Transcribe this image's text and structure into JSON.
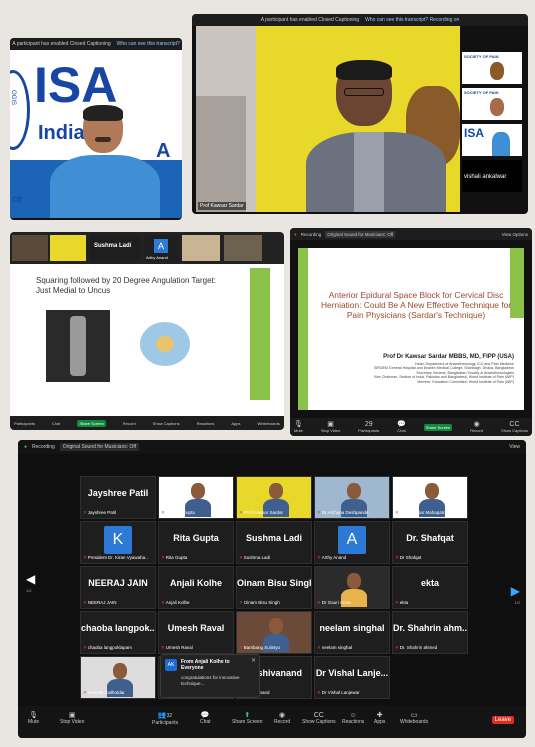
{
  "top_left": {
    "banner": "A participant has enabled Closed Captioning",
    "banner_q": "Who can see this transcript?",
    "logo": "ISA",
    "logo_sub1": "India",
    "logo_sub2": "A",
    "logo_side": "OGIS",
    "logo_side2": "ce"
  },
  "top_right": {
    "banner": "A participant has enabled Closed Captioning",
    "banner_q": "Who can see this transcript? Recording on",
    "speaker_label": "Prof Kawsar Sardar",
    "thumbs": [
      {
        "label": "SOCIETY OF PAIN"
      },
      {
        "label": "SOCIETY OF PAIN"
      },
      {
        "label": "ISA"
      },
      {
        "label": "vishali ankalwar"
      }
    ]
  },
  "mid_left": {
    "names": [
      "Sushma Ladi",
      "Arthy Anand",
      "A"
    ],
    "slide_title": "Squaring followed by 20 Degree Angulation Target: Just Medial to Uncus",
    "toolbar": [
      "Participants",
      "Chat",
      "Share Screen",
      "Record",
      "Show Captions",
      "Reactions",
      "Apps",
      "Whiteboards"
    ]
  },
  "mid_right": {
    "recording": "Recording",
    "sound": "Original Sound for Musicians: Off",
    "view": "View Options",
    "slide_title": "Anterior Epidural Space Block for Cervical Disc Herniation: Could Be A New Effective Technique for Pain Physicians (Sardar's Technique)",
    "presenter": "Prof Dr Kawsar Sardar MBBS, MD, FIPP (USA)",
    "lines": [
      "Head, Department of Anaesthesiology, ICU and Pain Medicine",
      "SIRDEM General Hospital and Ibrahim Medical College, Shahbagh, Dhaka, Bangladesh",
      "Secretary General, Bangladesh Society of Anaesthesiologists",
      "Vice Chairman, Section of India, Pakistan and Bangladesh, World Institute of Pain (WIP)",
      "Member, Education Committee, World Institute of Pain (WIP)"
    ],
    "toolbar": [
      "Mute",
      "Stop Video",
      "Participants",
      "Chat",
      "Share Screen",
      "Record",
      "Show Captions"
    ],
    "participants_count": "29"
  },
  "bottom": {
    "recording": "Recording",
    "sound": "Original Sound for Musicians: Off",
    "view": "View",
    "page_left": "1/2",
    "page_right": "1/2",
    "tiles": [
      {
        "name": "Jayshree Patil",
        "sub": "Jayshree Patil"
      },
      {
        "name": "",
        "sub": "Sumitra Gupta"
      },
      {
        "name": "",
        "sub": "Prof Kawsar Sardar"
      },
      {
        "name": "",
        "sub": "Dr Archana Deshpande"
      },
      {
        "name": "",
        "sub": "Prof Kawsar Mahapatra"
      },
      {
        "name": "",
        "sub": "President Dr. Kiran Vyawaha..."
      },
      {
        "name": "Rita Gupta",
        "sub": "Rita Gupta"
      },
      {
        "name": "Sushma Ladi",
        "sub": "Sushma Ladi"
      },
      {
        "name": "",
        "sub": "Arthy Anand"
      },
      {
        "name": "Dr. Shafqat",
        "sub": "Dr Shafqat"
      },
      {
        "name": "NEERAJ JAIN",
        "sub": "NEERAJ JAIN"
      },
      {
        "name": "Anjali Kolhe",
        "sub": "Anjali Kolhe"
      },
      {
        "name": "Oinam Bisu Singh",
        "sub": "Oinam Bisu Singh"
      },
      {
        "name": "",
        "sub": "Dr Gauri Arora"
      },
      {
        "name": "ekta",
        "sub": "ekta"
      },
      {
        "name": "chaoba langpok...",
        "sub": "chaoba langpoklapam"
      },
      {
        "name": "Umesh Raval",
        "sub": "Umesh Raval"
      },
      {
        "name": "",
        "sub": "Bambang Sulistyo"
      },
      {
        "name": "neelam singhal",
        "sub": "neelam singhal"
      },
      {
        "name": "Dr. Shahrin ahm...",
        "sub": "Dr. Shahrin ahmed"
      },
      {
        "name": "",
        "sub": "neelesh malhotdar"
      },
      {
        "name": "hal Sharma",
        "sub": "Sharma"
      },
      {
        "name": "dr shivanand",
        "sub": "dr shivanand"
      },
      {
        "name": "Dr Vishal Lanje...",
        "sub": "Dr Vishal Lanjewar"
      }
    ],
    "avatar_k": "K",
    "avatar_a": "A",
    "chat": {
      "badge": "AK",
      "from": "From Anjali Kolhe to Everyone",
      "msg": "congratulations for innovative technique..."
    },
    "toolbar": {
      "mute": "Mute",
      "stop_video": "Stop Video",
      "participants": "Participants",
      "participants_count": "32",
      "chat": "Chat",
      "share": "Share Screen",
      "record": "Record",
      "captions": "Show Captions",
      "reactions": "Reactions",
      "apps": "Apps",
      "whiteboards": "Whiteboards",
      "leave": "Leave"
    }
  }
}
